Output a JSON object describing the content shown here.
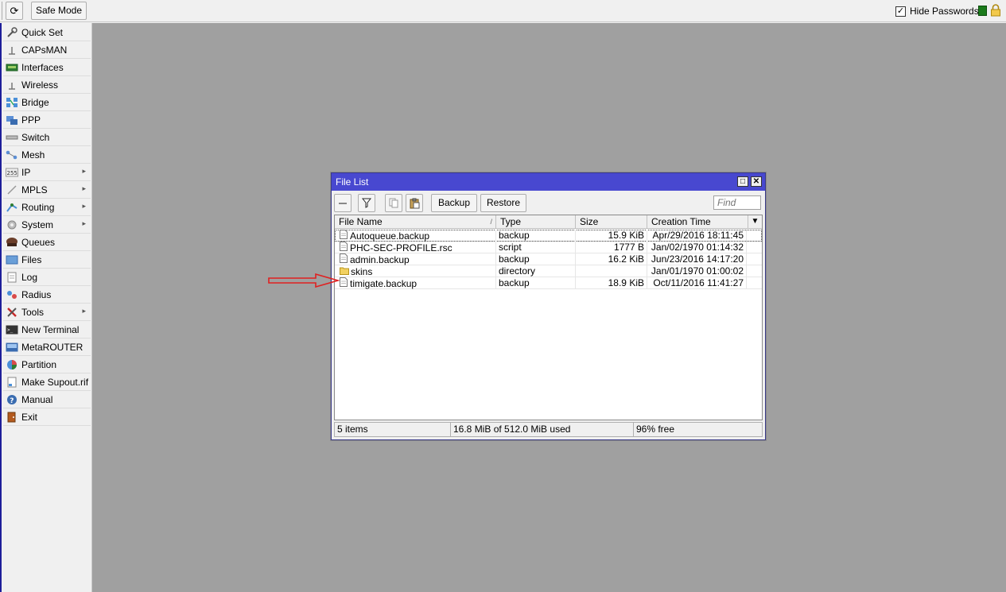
{
  "toolbar": {
    "refresh_icon": "refresh-icon",
    "safe_mode_label": "Safe Mode",
    "hide_passwords_label": "Hide Passwords",
    "hide_passwords_checked": true,
    "status_color": "#1b7a1b"
  },
  "sidebar": {
    "items": [
      {
        "label": "Quick Set",
        "icon": "quick-set-icon",
        "submenu": false
      },
      {
        "label": "CAPsMAN",
        "icon": "capsman-icon",
        "submenu": false
      },
      {
        "label": "Interfaces",
        "icon": "interfaces-icon",
        "submenu": false
      },
      {
        "label": "Wireless",
        "icon": "wireless-icon",
        "submenu": false
      },
      {
        "label": "Bridge",
        "icon": "bridge-icon",
        "submenu": false
      },
      {
        "label": "PPP",
        "icon": "ppp-icon",
        "submenu": false
      },
      {
        "label": "Switch",
        "icon": "switch-icon",
        "submenu": false
      },
      {
        "label": "Mesh",
        "icon": "mesh-icon",
        "submenu": false
      },
      {
        "label": "IP",
        "icon": "ip-icon",
        "submenu": true
      },
      {
        "label": "MPLS",
        "icon": "mpls-icon",
        "submenu": true
      },
      {
        "label": "Routing",
        "icon": "routing-icon",
        "submenu": true
      },
      {
        "label": "System",
        "icon": "system-icon",
        "submenu": true
      },
      {
        "label": "Queues",
        "icon": "queues-icon",
        "submenu": false
      },
      {
        "label": "Files",
        "icon": "files-icon",
        "submenu": false
      },
      {
        "label": "Log",
        "icon": "log-icon",
        "submenu": false
      },
      {
        "label": "Radius",
        "icon": "radius-icon",
        "submenu": false
      },
      {
        "label": "Tools",
        "icon": "tools-icon",
        "submenu": true
      },
      {
        "label": "New Terminal",
        "icon": "terminal-icon",
        "submenu": false
      },
      {
        "label": "MetaROUTER",
        "icon": "metarouter-icon",
        "submenu": false
      },
      {
        "label": "Partition",
        "icon": "partition-icon",
        "submenu": false
      },
      {
        "label": "Make Supout.rif",
        "icon": "supout-icon",
        "submenu": false
      },
      {
        "label": "Manual",
        "icon": "manual-icon",
        "submenu": false
      },
      {
        "label": "Exit",
        "icon": "exit-icon",
        "submenu": false
      }
    ]
  },
  "file_list": {
    "title": "File List",
    "backup_label": "Backup",
    "restore_label": "Restore",
    "find_placeholder": "Find",
    "columns": [
      "File Name",
      "Type",
      "Size",
      "Creation Time"
    ],
    "rows": [
      {
        "name": "Autoqueue.backup",
        "type": "backup",
        "size": "15.9 KiB",
        "time": "Apr/29/2016 18:11:45",
        "icon": "file-icon"
      },
      {
        "name": "PHC-SEC-PROFILE.rsc",
        "type": "script",
        "size": "1777 B",
        "time": "Jan/02/1970 01:14:32",
        "icon": "file-icon"
      },
      {
        "name": "admin.backup",
        "type": "backup",
        "size": "16.2 KiB",
        "time": "Jun/23/2016 14:17:20",
        "icon": "file-icon"
      },
      {
        "name": "skins",
        "type": "directory",
        "size": "",
        "time": "Jan/01/1970 01:00:02",
        "icon": "folder-icon"
      },
      {
        "name": "timigate.backup",
        "type": "backup",
        "size": "18.9 KiB",
        "time": "Oct/11/2016 11:41:27",
        "icon": "file-icon"
      }
    ],
    "status": {
      "items": "5 items",
      "used": "16.8 MiB of 512.0 MiB used",
      "free": "96% free"
    }
  },
  "annotation": {
    "arrow_color": "#e02020"
  }
}
